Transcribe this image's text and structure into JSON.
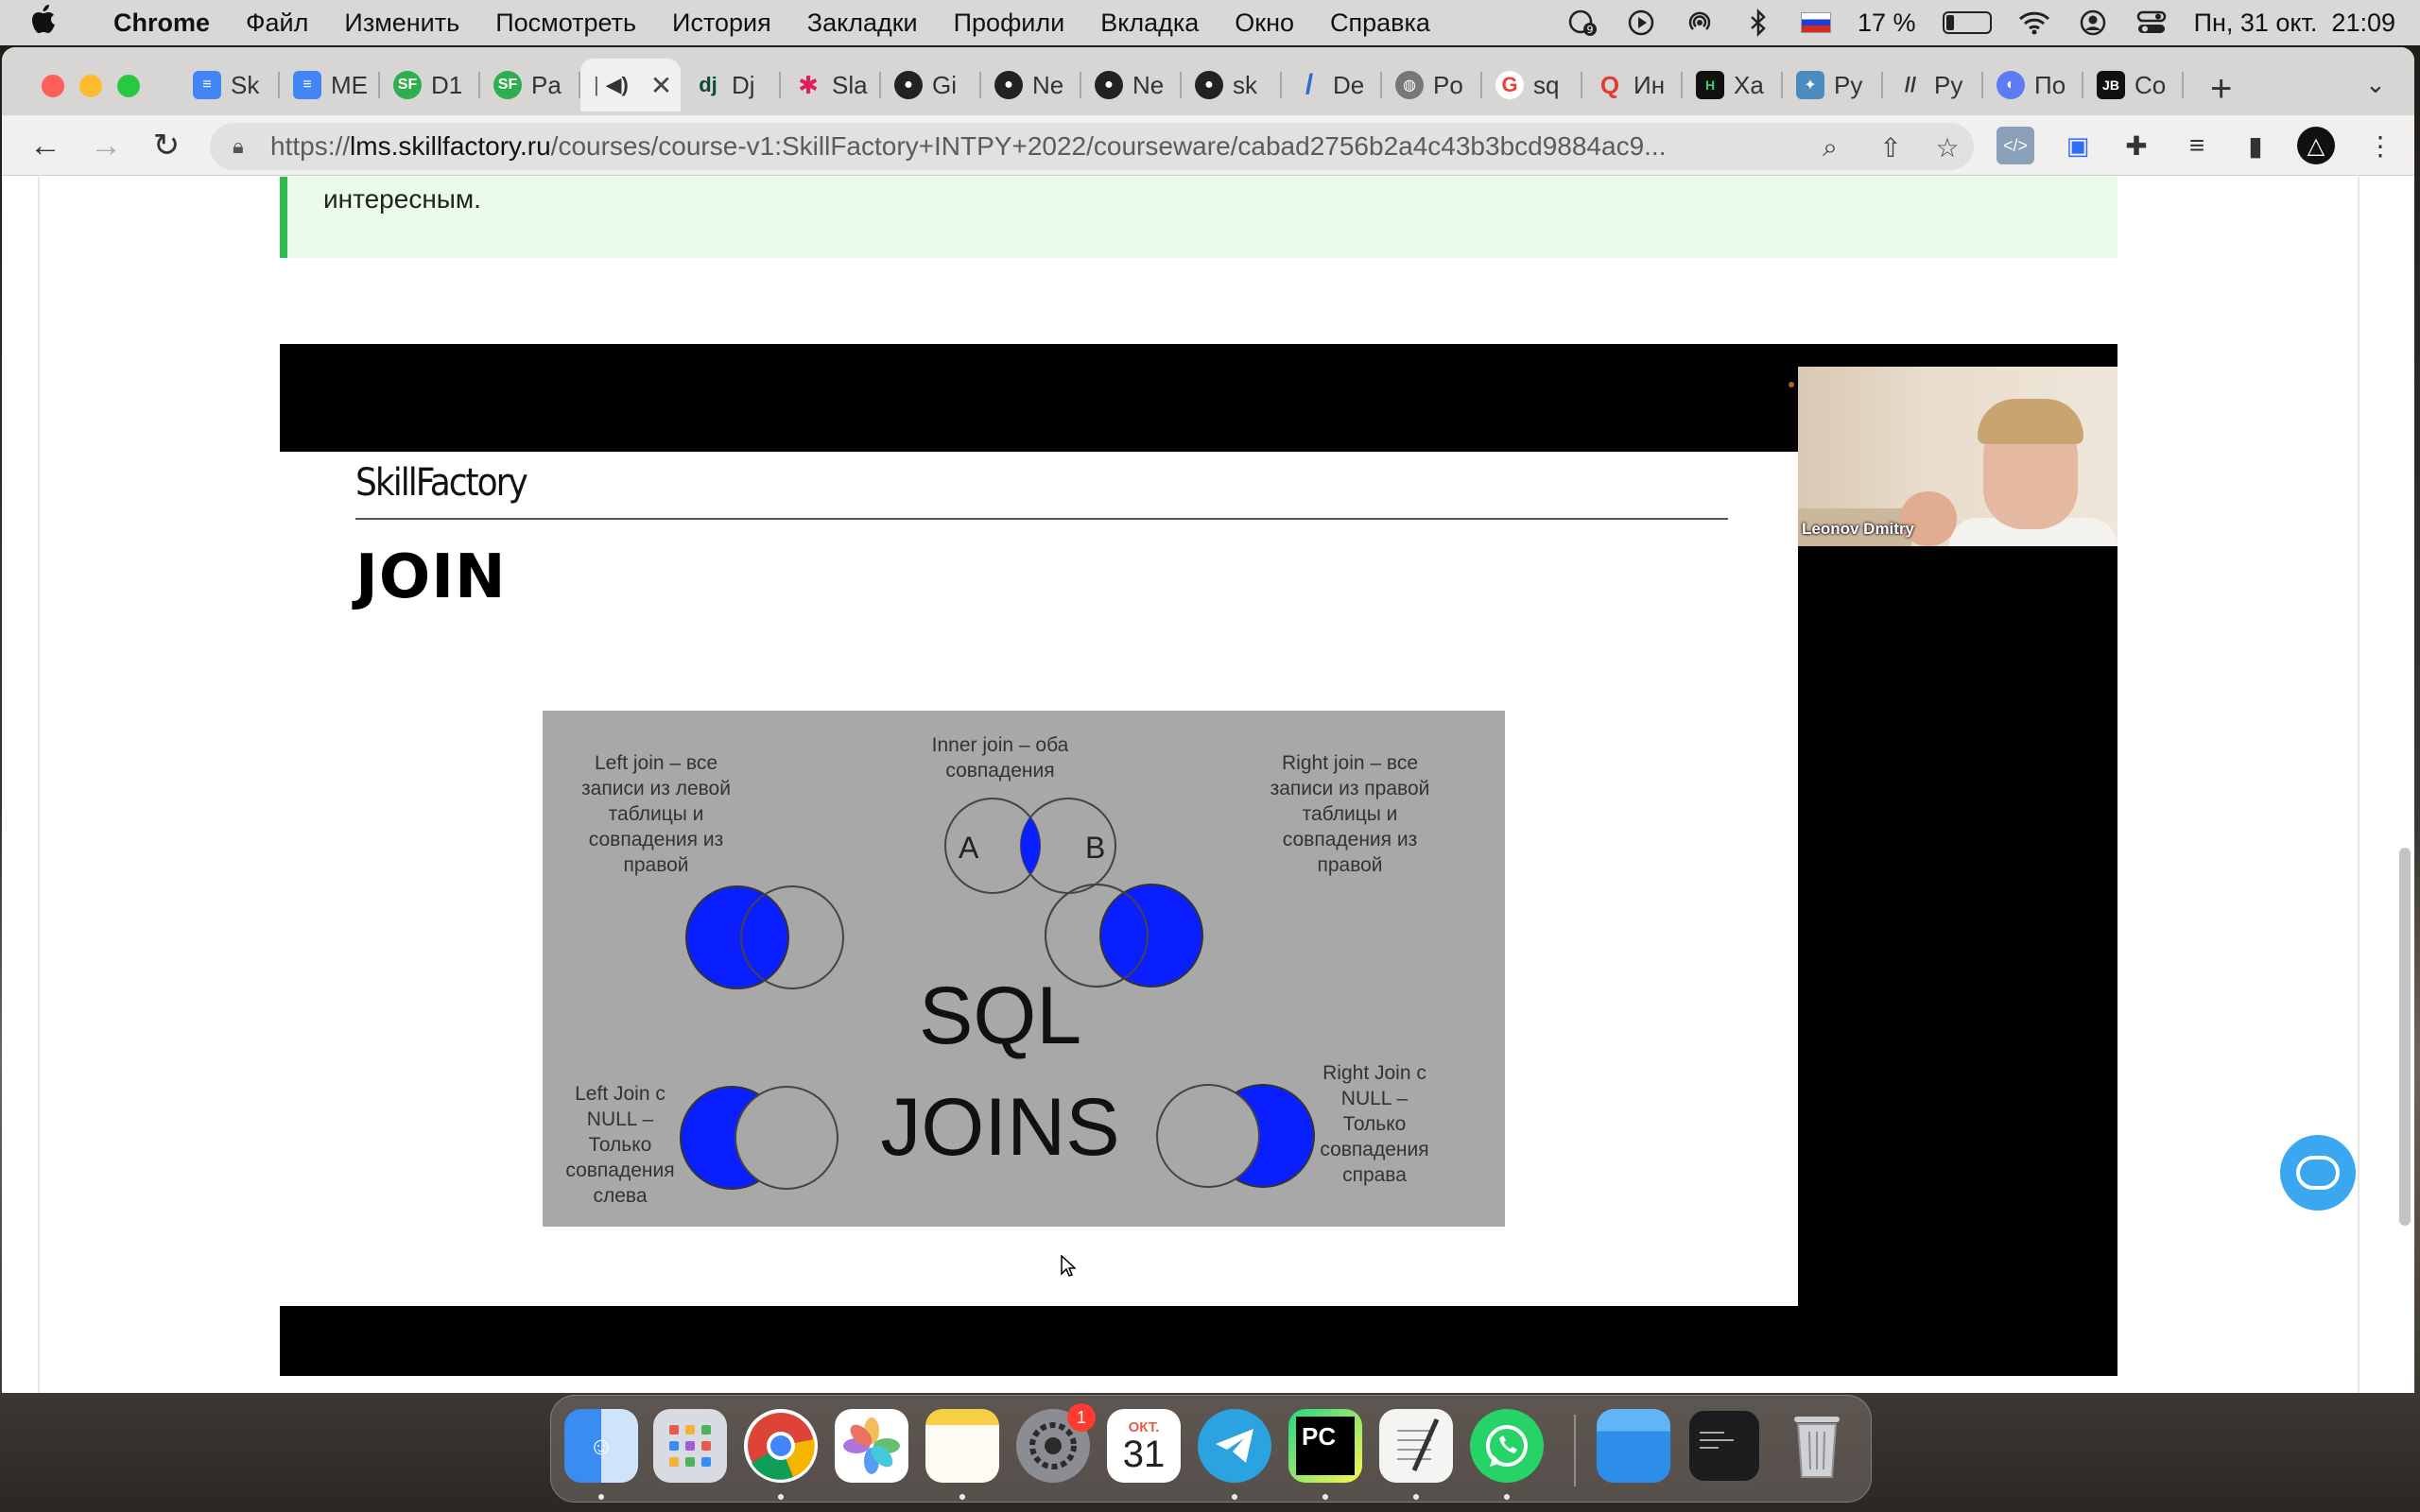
{
  "menubar": {
    "apple": "",
    "app": "Chrome",
    "items": [
      "Файл",
      "Изменить",
      "Посмотреть",
      "История",
      "Закладки",
      "Профили",
      "Вкладка",
      "Окно",
      "Справка"
    ],
    "status": {
      "notifications_count": "9",
      "battery": "17 %",
      "battery_level": 0.17,
      "datetime": "Пн, 31 окт.  21:09"
    }
  },
  "tabs": [
    {
      "label": "Sk",
      "icon": "google-docs-icon",
      "color": "#4285f4"
    },
    {
      "label": "МЕ",
      "icon": "google-docs-icon",
      "color": "#4285f4"
    },
    {
      "label": "D1",
      "icon": "skillfactory-icon",
      "color": "#2fae4f"
    },
    {
      "label": "Pa",
      "icon": "skillfactory-icon",
      "color": "#2fae4f"
    },
    {
      "label": "",
      "icon": "audio-icon",
      "color": "#f1f0ef",
      "active": true
    },
    {
      "label": "Dj",
      "icon": "django-icon",
      "color": "#0c4b33"
    },
    {
      "label": "Sla",
      "icon": "slack-icon",
      "color": "#4a154b"
    },
    {
      "label": "Gi",
      "icon": "github-icon",
      "color": "#222222"
    },
    {
      "label": "Ne",
      "icon": "github-icon",
      "color": "#222222"
    },
    {
      "label": "Ne",
      "icon": "github-icon",
      "color": "#222222"
    },
    {
      "label": "sk",
      "icon": "github-icon",
      "color": "#222222"
    },
    {
      "label": "De",
      "icon": "slash-icon",
      "color": "#2b6cd1"
    },
    {
      "label": "Po",
      "icon": "globe-icon",
      "color": "#777777"
    },
    {
      "label": "sq",
      "icon": "google-icon",
      "color": "#ea4335"
    },
    {
      "label": "Ин",
      "icon": "search-icon",
      "color": "#e53935"
    },
    {
      "label": "Ха",
      "icon": "hexlet-icon",
      "color": "#111111"
    },
    {
      "label": "Py",
      "icon": "python-icon",
      "color": "#4b8bbe"
    },
    {
      "label": "Py",
      "icon": "python-icon",
      "color": "#333333"
    },
    {
      "label": "По",
      "icon": "browser-icon",
      "color": "#5b7cf5"
    },
    {
      "label": "Co",
      "icon": "jetbrains-icon",
      "color": "#111111"
    }
  ],
  "address": {
    "protocol": "https://",
    "host": "lms.skillfactory.ru",
    "path": "/courses/course-v1:SkillFactory+INTPY+2022/courseware/cabad2756b2a4c43b3bcd9884ac9..."
  },
  "page": {
    "callout_text": "интересным.",
    "slide": {
      "brand": "SkillFactory",
      "title": "JOIN",
      "labels": {
        "left": [
          "Left join – все",
          "записи из левой",
          "таблицы и",
          "совпадения из",
          "правой"
        ],
        "inner": [
          "Inner join – оба",
          "совпадения"
        ],
        "right": [
          "Right join – все",
          "записи из правой",
          "таблицы и",
          "совпадения из",
          "правой"
        ],
        "left_null": [
          "Left Join с",
          "NULL –",
          "Только",
          "совпадения",
          "слева"
        ],
        "right_null": [
          "Right Join с",
          "NULL –",
          "Только",
          "совпадения",
          "справа"
        ],
        "circle_a": "A",
        "circle_b": "B",
        "center_1": "SQL",
        "center_2": "JOINS"
      }
    },
    "speaker_name": "Leonov Dmitry"
  },
  "dock": {
    "calendar_month": "ОКТ.",
    "calendar_day": "31",
    "settings_badge": "1"
  },
  "colors": {
    "accent_green": "#2fbb4f",
    "venn_blue": "#0a1fff",
    "chat_blue": "#3aa7f0"
  }
}
